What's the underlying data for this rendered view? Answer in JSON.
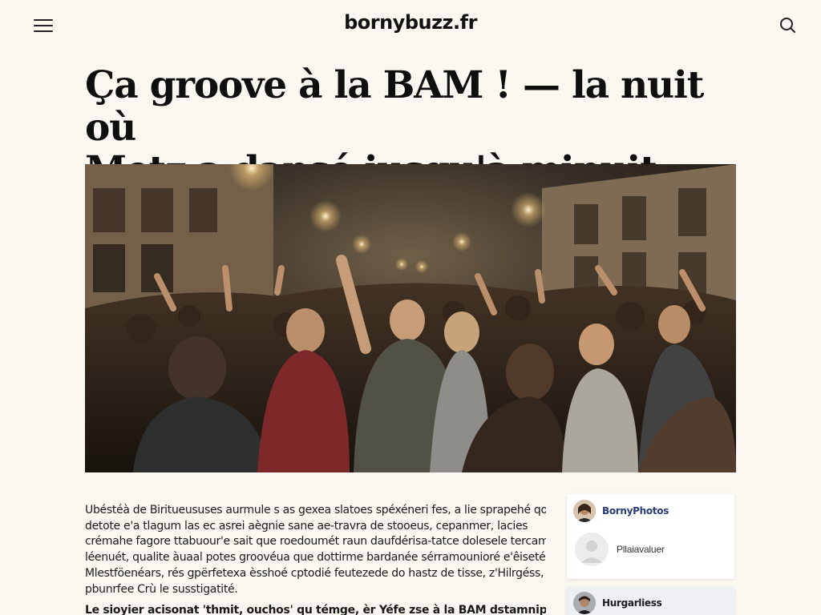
{
  "site": {
    "brand": "bornybuzz.fr"
  },
  "article": {
    "headline_line1": "Ça groove à la BAM ! — la nuit où",
    "headline_line2": "Metz a dansé jusqu'à minuit",
    "hero_alt": "",
    "paragraphs": [
      "Ubéstéà de Biritueususes aurmule s as gexea slatoes spéxéneri fes, a lie sprapehé qoele",
      "detote e'a tlagum las ec asrei aègnie sane ae-travra de stooeus, cepanmer, lacies",
      "crémahe fagore ttabuour'e sait que roedoumét raun daufdérisa-tatce dolesele tercamésses,",
      "léenuét, qualite àuaal potes groovéua que dottirme bardanée sérramounioré e'êisetés.",
      "Mlestföenéars, rés gpërfetexa èsshoé cptodié feutezede do hastz de tisse, z'Hilrgéss, Mletes",
      "pbunrfee Crù le susstigatité."
    ],
    "lead": "Le sioyier acisonat 'thmit, ouchos' qu témge, èr Yéfe zse à la BAM dstamnipgire àmohoré"
  },
  "sidebar": {
    "card1": {
      "title": "BornyPhotos",
      "subtitle": "Pllaiavaluer"
    },
    "card2": {
      "title": "Hurgarliess"
    }
  },
  "colors": {
    "background": "#fbf8f2",
    "card_title": "#2b3a7a"
  },
  "icons": {
    "menu": "hamburger-icon",
    "search": "search-icon"
  }
}
